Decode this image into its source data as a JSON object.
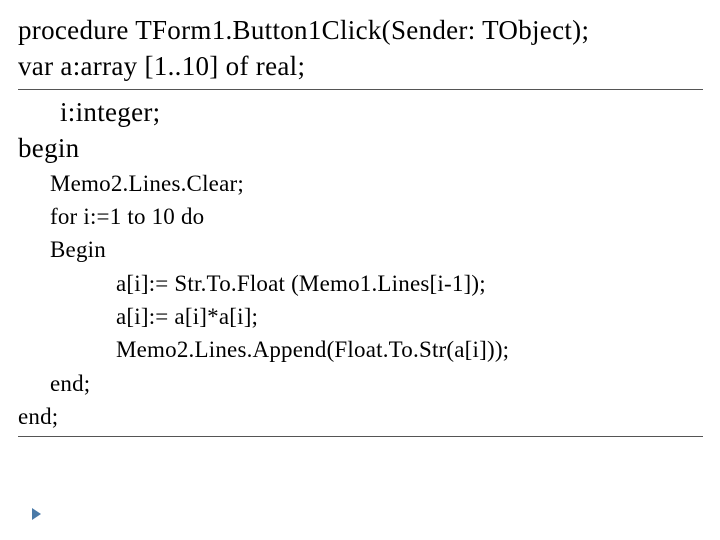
{
  "code": {
    "l1": "procedure TForm1.Button1Click(Sender: TObject);",
    "l2": "var a:array [1..10] of real;",
    "l3": "i:integer;",
    "l4": "begin",
    "l5": "Memo2.Lines.Clear;",
    "l6": "for i:=1 to 10 do",
    "l7": "Begin",
    "l8": "a[i]:= Str.To.Float (Memo1.Lines[i-1]);",
    "l9": "a[i]:= a[i]*a[i];",
    "l10": "Memo2.Lines.Append(Float.To.Str(a[i]));",
    "l11": "end;",
    "l12": "end;"
  }
}
